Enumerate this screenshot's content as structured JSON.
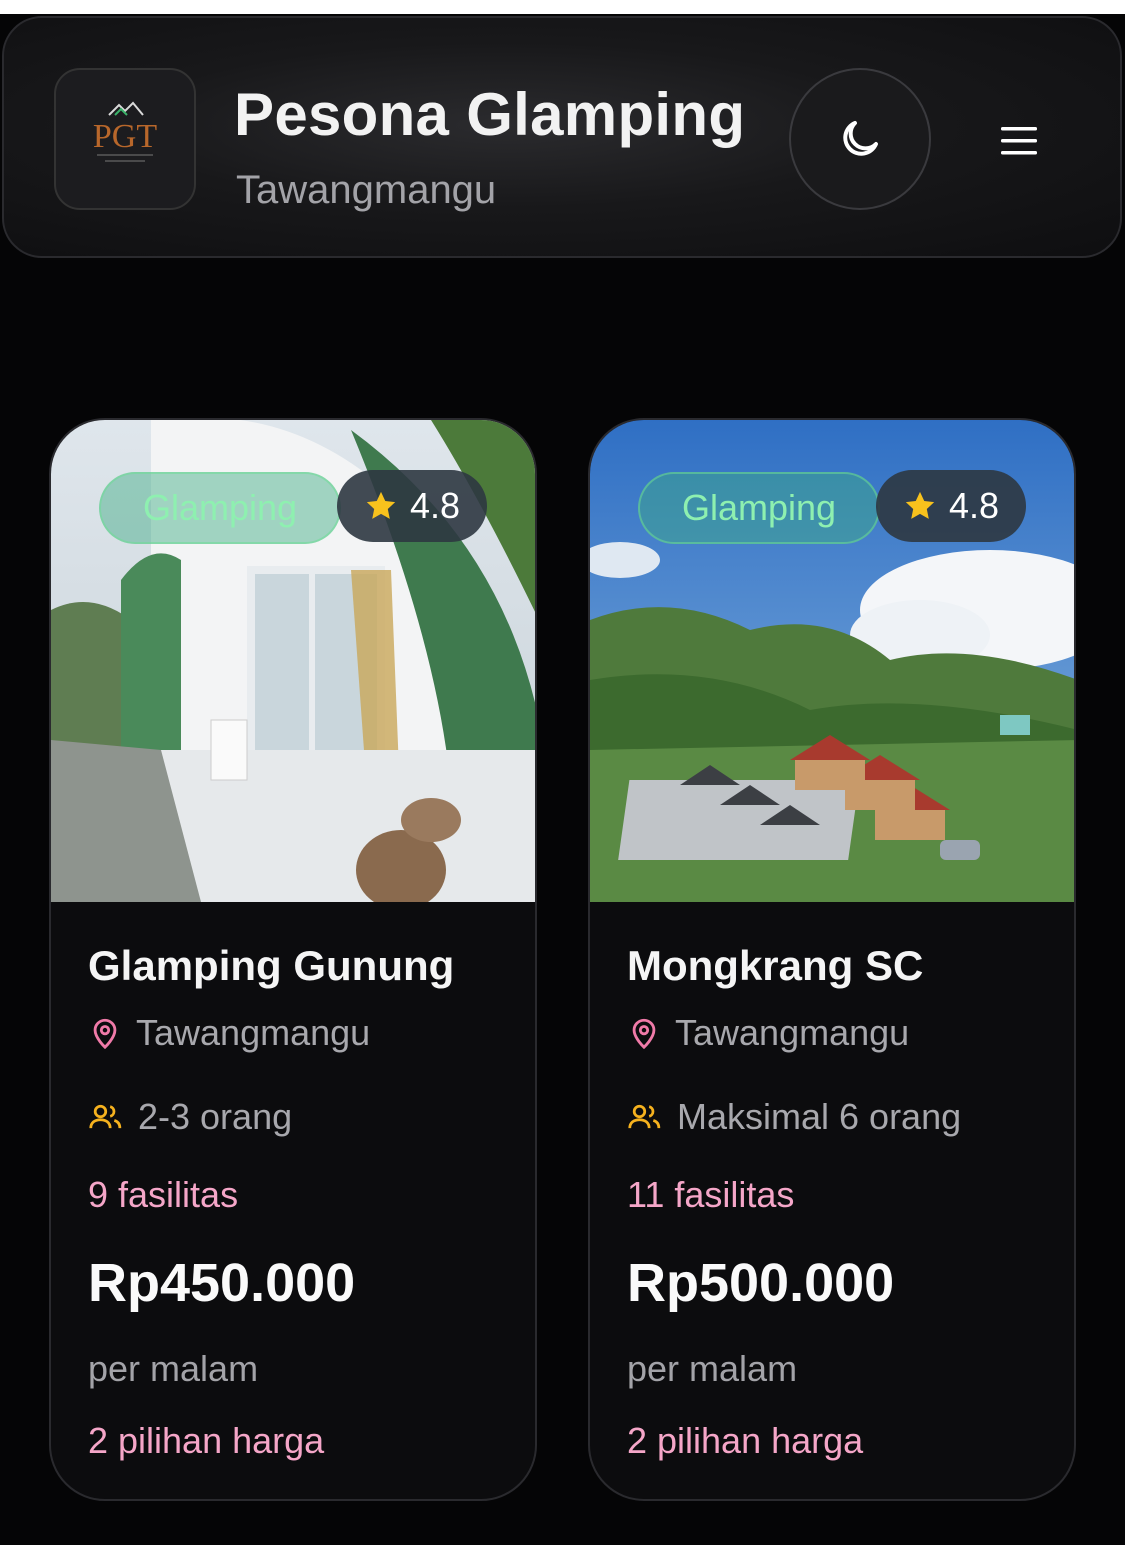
{
  "header": {
    "logo_text": "PGT",
    "title": "Pesona Glamping",
    "subtitle": "Tawangmangu",
    "theme_icon": "moon-icon",
    "menu_icon": "hamburger-menu-icon"
  },
  "listings": [
    {
      "category": "Glamping",
      "rating": "4.8",
      "name": "Glamping Gunung",
      "location": "Tawangmangu",
      "capacity": "2-3 orang",
      "facilities": "9 fasilitas",
      "price": "Rp450.000",
      "price_unit": "per malam",
      "price_options": "2 pilihan harga"
    },
    {
      "category": "Glamping",
      "rating": "4.8",
      "name": "Mongkrang SC",
      "location": "Tawangmangu",
      "capacity": "Maksimal 6 orang",
      "facilities": "11 fasilitas",
      "price": "Rp500.000",
      "price_unit": "per malam",
      "price_options": "2 pilihan harga"
    }
  ],
  "colors": {
    "accent_pink": "#f5a6c8",
    "badge_green": "#8ef0b0",
    "star": "#f8c21d",
    "location_icon": "#f07aa8",
    "people_icon": "#f6b21e"
  }
}
